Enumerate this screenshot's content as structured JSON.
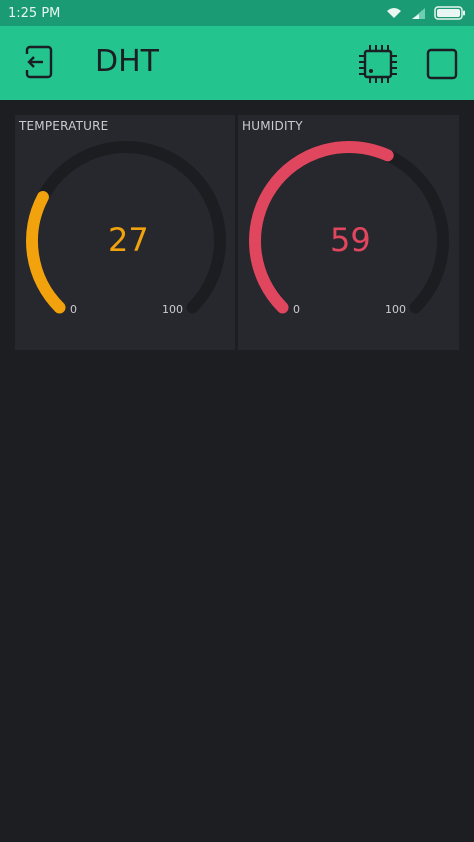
{
  "status_bar": {
    "time": "1:25 PM"
  },
  "app_bar": {
    "title": "DHT"
  },
  "widgets": [
    {
      "label": "TEMPERATURE",
      "value": "27",
      "value_fraction": 0.27,
      "min": "0",
      "max": "100",
      "color": "#f2a20c"
    },
    {
      "label": "HUMIDITY",
      "value": "59",
      "value_fraction": 0.59,
      "min": "0",
      "max": "100",
      "color": "#e0475f"
    }
  ],
  "colors": {
    "status_bar": "#1a9b73",
    "app_bar": "#23c48e",
    "background": "#1c1e22",
    "widget": "#26282d",
    "gauge_track": "#1c1d21"
  }
}
